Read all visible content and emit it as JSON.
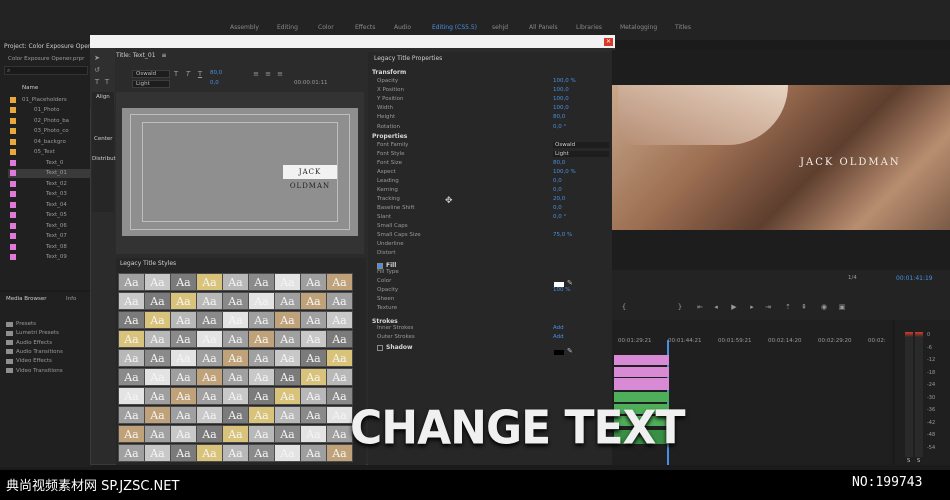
{
  "workspace_tabs": [
    {
      "label": "Assembly"
    },
    {
      "label": "Editing"
    },
    {
      "label": "Color"
    },
    {
      "label": "Effects"
    },
    {
      "label": "Audio"
    },
    {
      "label": "Editing (CS5.5)"
    },
    {
      "label": "sehjd"
    },
    {
      "label": "All Panels"
    },
    {
      "label": "Libraries"
    },
    {
      "label": "Metalogging"
    },
    {
      "label": "Titles"
    }
  ],
  "project": {
    "title": "Project: Color Exposure Opener",
    "file": "Color Exposure Opener.prpr",
    "name_header": "Name",
    "items": [
      {
        "label": "01_Placeholders",
        "color": "#e8a93c"
      },
      {
        "label": "01_Photo",
        "color": "#e8a93c"
      },
      {
        "label": "02_Photo_ba",
        "color": "#e8a93c"
      },
      {
        "label": "03_Photo_co",
        "color": "#e8a93c"
      },
      {
        "label": "04_backgro",
        "color": "#e8a93c"
      },
      {
        "label": "05_Text",
        "color": "#e8a93c"
      },
      {
        "label": "Text_0",
        "color": "#e07ad9"
      },
      {
        "label": "Text_01",
        "color": "#e07ad9"
      },
      {
        "label": "Text_02",
        "color": "#e07ad9"
      },
      {
        "label": "Text_03",
        "color": "#e07ad9"
      },
      {
        "label": "Text_04",
        "color": "#e07ad9"
      },
      {
        "label": "Text_05",
        "color": "#e07ad9"
      },
      {
        "label": "Text_06",
        "color": "#e07ad9"
      },
      {
        "label": "Text_07",
        "color": "#e07ad9"
      },
      {
        "label": "Text_08",
        "color": "#e07ad9"
      },
      {
        "label": "Text_09",
        "color": "#e07ad9"
      }
    ]
  },
  "media_browser": {
    "tabs": [
      "Media Browser",
      "Info"
    ],
    "items": [
      "Presets",
      "Lumetri Presets",
      "Audio Effects",
      "Audio Transitions",
      "Video Effects",
      "Video Transitions"
    ]
  },
  "titler": {
    "title": "Title: Text_01",
    "font": "Oswald",
    "style": "Light",
    "size": "80,0",
    "kerning": "0,0",
    "timecode": "00:00:01:11",
    "canvas_text": "JACK OLDMAN",
    "align_label": "Align",
    "center_label": "Center",
    "distribute_label": "Distribut",
    "styles_title": "Legacy Title Styles",
    "style_glyph": "Aa"
  },
  "properties": {
    "title": "Legacy Title Properties",
    "sections": {
      "transform": "Transform",
      "properties": "Properties",
      "fill": "Fill",
      "strokes": "Strokes",
      "shadow": "Shadow"
    },
    "rows": [
      {
        "label": "Opacity",
        "value": "100,0 %"
      },
      {
        "label": "X Position",
        "value": "100,0"
      },
      {
        "label": "Y Position",
        "value": "100,0"
      },
      {
        "label": "Width",
        "value": "100,0"
      },
      {
        "label": "Height",
        "value": "80,0"
      },
      {
        "label": "Rotation",
        "value": "0,0 °"
      },
      {
        "label": "Font Family",
        "value": "Oswald"
      },
      {
        "label": "Font Style",
        "value": "Light"
      },
      {
        "label": "Font Size",
        "value": "80,0"
      },
      {
        "label": "Aspect",
        "value": "100,0 %"
      },
      {
        "label": "Leading",
        "value": "0,0"
      },
      {
        "label": "Kerning",
        "value": "0,0"
      },
      {
        "label": "Tracking",
        "value": "20,0"
      },
      {
        "label": "Baseline Shift",
        "value": "0,0"
      },
      {
        "label": "Slant",
        "value": "0,0 °"
      },
      {
        "label": "Small Caps",
        "value": ""
      },
      {
        "label": "Small Caps Size",
        "value": "75,0 %"
      },
      {
        "label": "Underline",
        "value": ""
      },
      {
        "label": "Distort",
        "value": ""
      },
      {
        "label": "Fill Type",
        "value": ""
      },
      {
        "label": "Color",
        "value": ""
      },
      {
        "label": "Opacity",
        "value": "100 %"
      },
      {
        "label": "Sheen",
        "value": ""
      },
      {
        "label": "Texture",
        "value": ""
      },
      {
        "label": "Inner Strokes",
        "value": "Add"
      },
      {
        "label": "Outer Strokes",
        "value": "Add"
      }
    ]
  },
  "program": {
    "overlay_text": "JACK OLDMAN",
    "scale": "1/4",
    "timecode": "00:01:41:19"
  },
  "timeline": {
    "timecodes": [
      "00:01:29:21",
      "00:01:44:21",
      "00:01:59:21",
      "00:02:14:20",
      "00:02:29:20",
      "00:02:"
    ]
  },
  "meters": {
    "labels": [
      "0",
      "-6",
      "-12",
      "-18",
      "-24",
      "-30",
      "-36",
      "-42",
      "-48",
      "-54"
    ],
    "solo": [
      "S",
      "S"
    ]
  },
  "overlay": {
    "caption": "CHANGE TEXT"
  },
  "watermark": {
    "left": "典尚视频素材网 SP.JZSC.NET",
    "right": "NO:199743"
  },
  "colors": {
    "accent": "#4a90e2",
    "close": "#d7392b",
    "label_orange": "#e8a93c",
    "label_pink": "#e07ad9",
    "clip_pink": "#d98ad4",
    "clip_green": "#4fae5a"
  }
}
